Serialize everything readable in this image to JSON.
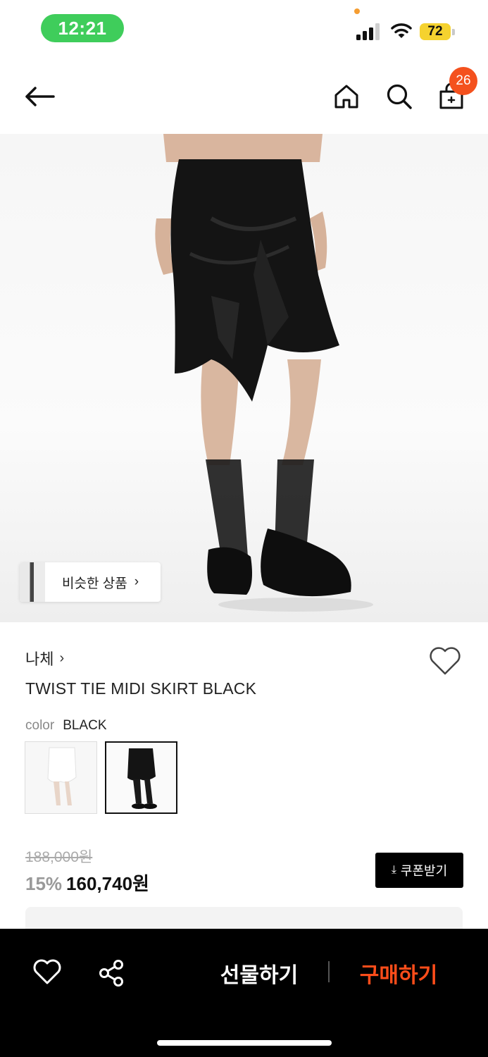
{
  "status_bar": {
    "time": "12:21",
    "battery": "72"
  },
  "nav": {
    "cart_count": "26"
  },
  "similar": {
    "label": "비슷한 상품",
    "chevron": "›"
  },
  "product": {
    "brand": "나체",
    "brand_chevron": "›",
    "title": "TWIST TIE MIDI SKIRT BLACK",
    "color_key": "color",
    "color_value": "BLACK",
    "original_price": "188,000원",
    "discount": "15%",
    "sale_price": "160,740원",
    "coupon_label": "쿠폰받기",
    "coupon_icon": "download-icon"
  },
  "bottom_bar": {
    "gift_label": "선물하기",
    "buy_label": "구매하기"
  },
  "colors": {
    "status_green": "#3fcd5b",
    "badge": "#f4511e",
    "buy": "#ff4d1a",
    "battery": "#f5d22f"
  }
}
